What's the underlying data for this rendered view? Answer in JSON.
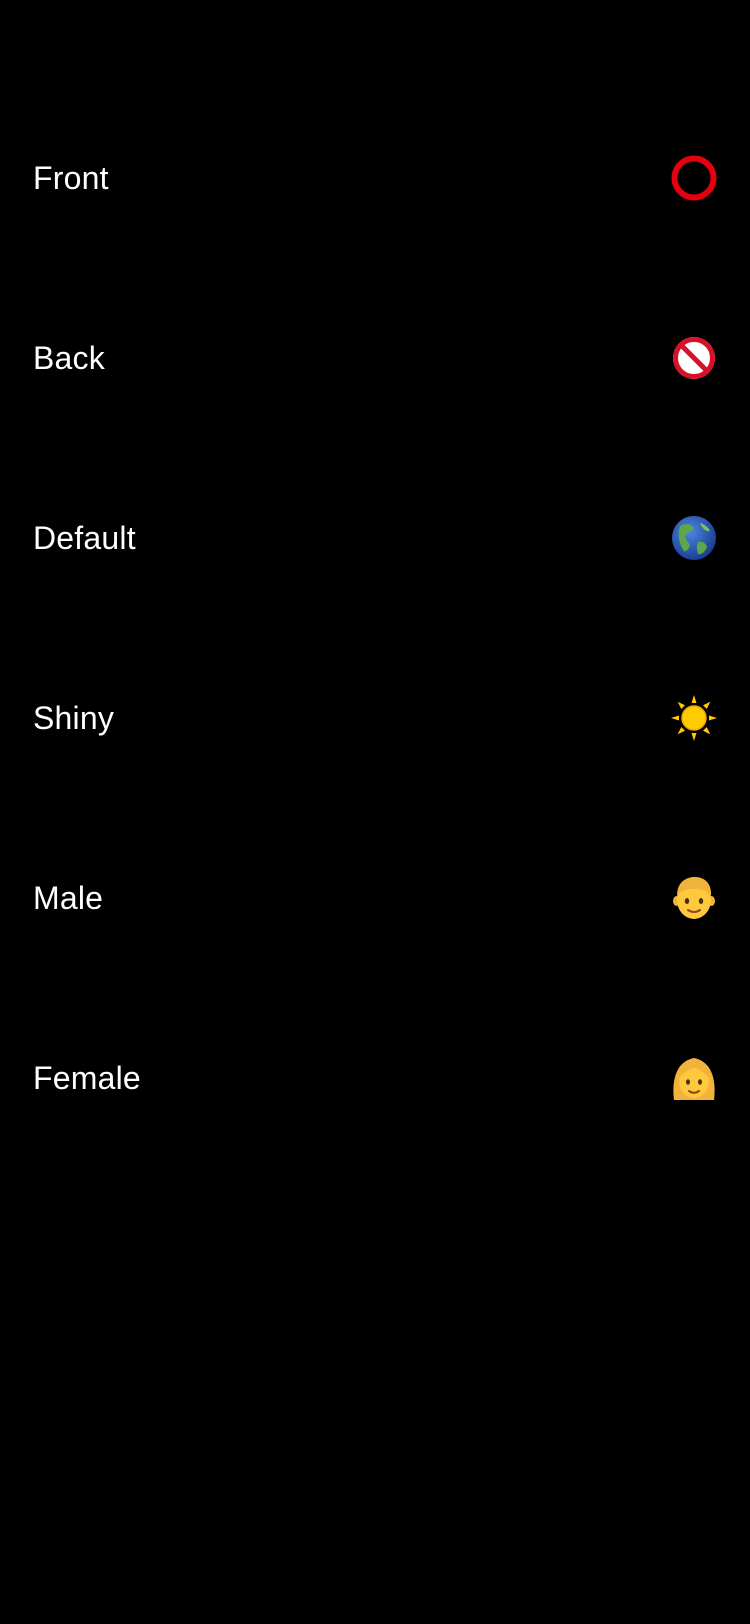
{
  "colors": {
    "background": "#000000",
    "text": "#ffffff",
    "ring": "#e3000f",
    "prohibit": "#d9102a",
    "sun": "#ffcc00",
    "skin": "#ffc83d",
    "hair": "#f2b33b"
  },
  "rows": [
    {
      "label": "Front",
      "icon": "red-circle-icon"
    },
    {
      "label": "Back",
      "icon": "prohibited-icon"
    },
    {
      "label": "Default",
      "icon": "globe-icon"
    },
    {
      "label": "Shiny",
      "icon": "sun-icon"
    },
    {
      "label": "Male",
      "icon": "boy-face-icon"
    },
    {
      "label": "Female",
      "icon": "woman-face-icon"
    }
  ]
}
